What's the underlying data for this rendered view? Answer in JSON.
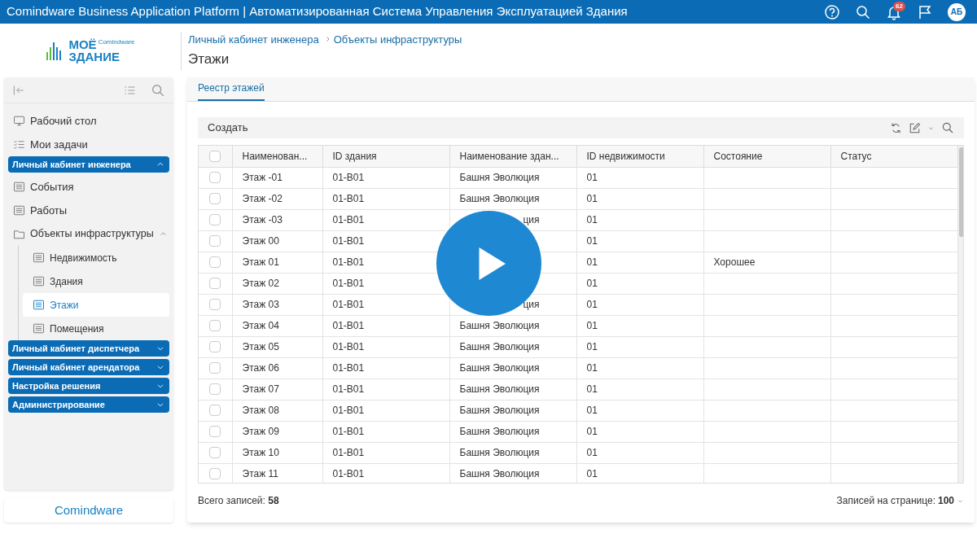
{
  "topbar": {
    "title": "Comindware Business Application Platform | Автоматизированная Система Управления Эксплуатацией Здания",
    "notifications": "62",
    "avatar": "АБ"
  },
  "logo": {
    "line1": "МОЁ",
    "line2": "ЗДАНИЕ",
    "small": "Comindware"
  },
  "breadcrumbs": [
    "Личный кабинет инженера",
    "Объекты инфраструктуры"
  ],
  "page_title": "Этажи",
  "sidebar": {
    "items": [
      {
        "kind": "desktop",
        "label": "Рабочий стол",
        "selected": false
      },
      {
        "kind": "tasks",
        "label": "Мои задачи",
        "selected": false
      },
      {
        "kind": "section",
        "label": "Личный кабинет инженера",
        "expanded": true,
        "children": [
          {
            "kind": "page",
            "label": "События",
            "selected": false
          },
          {
            "kind": "page",
            "label": "Работы",
            "selected": false
          },
          {
            "kind": "folder",
            "label": "Объекты инфраструктуры",
            "expanded": true,
            "children": [
              {
                "kind": "page",
                "label": "Недвижимость",
                "selected": false
              },
              {
                "kind": "page",
                "label": "Здания",
                "selected": false
              },
              {
                "kind": "page",
                "label": "Этажи",
                "selected": true
              },
              {
                "kind": "page",
                "label": "Помещения",
                "selected": false
              }
            ]
          }
        ]
      },
      {
        "kind": "section",
        "label": "Личный кабинет диспетчера",
        "expanded": false
      },
      {
        "kind": "section",
        "label": "Личный кабинет арендатора",
        "expanded": false
      },
      {
        "kind": "section",
        "label": "Настройка решения",
        "expanded": false
      },
      {
        "kind": "section",
        "label": "Администрирование",
        "expanded": false
      }
    ],
    "footer_logo": "Comindware"
  },
  "tabs": [
    {
      "label": "Реестр этажей",
      "selected": true
    }
  ],
  "toolbar": {
    "create": "Создать"
  },
  "table": {
    "columns": [
      "Наименован...",
      "ID здания",
      "Наименование здан...",
      "ID недвижимости",
      "Состояние",
      "Статус"
    ],
    "all_checked": false,
    "rows": [
      {
        "checked": false,
        "cells": [
          "Этаж -01",
          "01-B01",
          "Башня Эволюция",
          "01",
          "",
          ""
        ]
      },
      {
        "checked": false,
        "cells": [
          "Этаж -02",
          "01-B01",
          "Башня Эволюция",
          "01",
          "",
          ""
        ]
      },
      {
        "checked": false,
        "cells": [
          "Этаж -03",
          "01-B01",
          {
            "kind": "tail",
            "text": "ция"
          },
          "01",
          "",
          ""
        ]
      },
      {
        "checked": false,
        "cells": [
          "Этаж 00",
          "01-B01",
          "",
          "01",
          "",
          ""
        ]
      },
      {
        "checked": false,
        "cells": [
          "Этаж 01",
          "01-B01",
          "",
          "01",
          "Хорошее",
          ""
        ]
      },
      {
        "checked": false,
        "cells": [
          "Этаж 02",
          "01-B01",
          "",
          "01",
          "",
          ""
        ]
      },
      {
        "checked": false,
        "cells": [
          "Этаж 03",
          "01-B01",
          {
            "kind": "tail",
            "text": "ция"
          },
          "01",
          "",
          ""
        ]
      },
      {
        "checked": false,
        "cells": [
          "Этаж 04",
          "01-B01",
          "Башня Эволюция",
          "01",
          "",
          ""
        ]
      },
      {
        "checked": false,
        "cells": [
          "Этаж 05",
          "01-B01",
          "Башня Эволюция",
          "01",
          "",
          ""
        ]
      },
      {
        "checked": false,
        "cells": [
          "Этаж 06",
          "01-B01",
          "Башня Эволюция",
          "01",
          "",
          ""
        ]
      },
      {
        "checked": false,
        "cells": [
          "Этаж 07",
          "01-B01",
          "Башня Эволюция",
          "01",
          "",
          ""
        ]
      },
      {
        "checked": false,
        "cells": [
          "Этаж 08",
          "01-B01",
          "Башня Эволюция",
          "01",
          "",
          ""
        ]
      },
      {
        "checked": false,
        "cells": [
          "Этаж 09",
          "01-B01",
          "Башня Эволюция",
          "01",
          "",
          ""
        ]
      },
      {
        "checked": false,
        "cells": [
          "Этаж 10",
          "01-B01",
          "Башня Эволюция",
          "01",
          "",
          ""
        ]
      },
      {
        "checked": false,
        "cells": [
          "Этаж 11",
          "01-B01",
          "Башня Эволюция",
          "01",
          "",
          ""
        ]
      }
    ]
  },
  "footer": {
    "total_label": "Всего записей:",
    "total": "58",
    "per_page_label": "Записей на странице:",
    "per_page": "100"
  }
}
